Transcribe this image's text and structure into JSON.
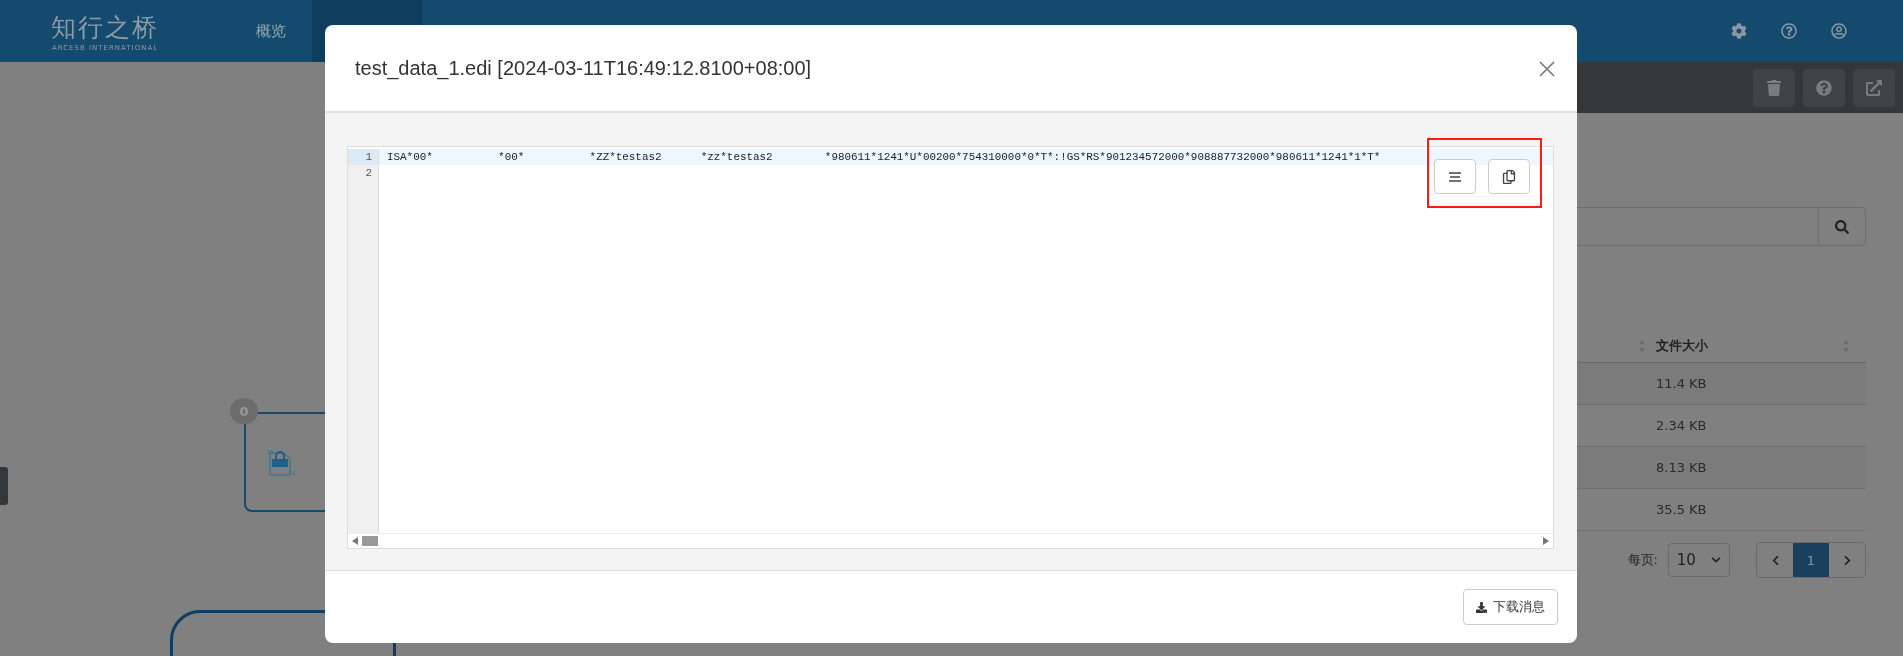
{
  "header": {
    "logo": "知行之桥",
    "logo_subtitle": "ARCESB INTERNATIONAL",
    "nav": [
      {
        "label": "概览",
        "selected": false
      },
      {
        "selected": true
      }
    ]
  },
  "canvas": {
    "nodes": [
      {
        "badge": "0",
        "kind": "as2"
      },
      {
        "kind": "plain"
      }
    ]
  },
  "table": {
    "columns": [
      {
        "label": "文件大小"
      }
    ],
    "rows": [
      {
        "size": "11.4 KB"
      },
      {
        "size": "2.34 KB"
      },
      {
        "size": "8.13 KB"
      },
      {
        "size": "35.5 KB"
      }
    ]
  },
  "pagination": {
    "per_page_label": "每页:",
    "per_page": "10",
    "pages": [
      {
        "label": "1",
        "selected": true
      }
    ]
  },
  "modal": {
    "title": "test_data_1.edi [2024-03-11T16:49:12.8100+08:00]",
    "editor": {
      "lines": [
        {
          "number": "1",
          "text": "ISA*00*          *00*          *ZZ*testas2      *zz*testas2        *980611*1241*U*00200*754310000*0*T*:!GS*RS*901234572000*908887732000*980611*1241*1*T*",
          "active": true
        },
        {
          "number": "2",
          "active": false
        }
      ],
      "tools_highlighted": true
    },
    "download_button": "下载消息"
  }
}
